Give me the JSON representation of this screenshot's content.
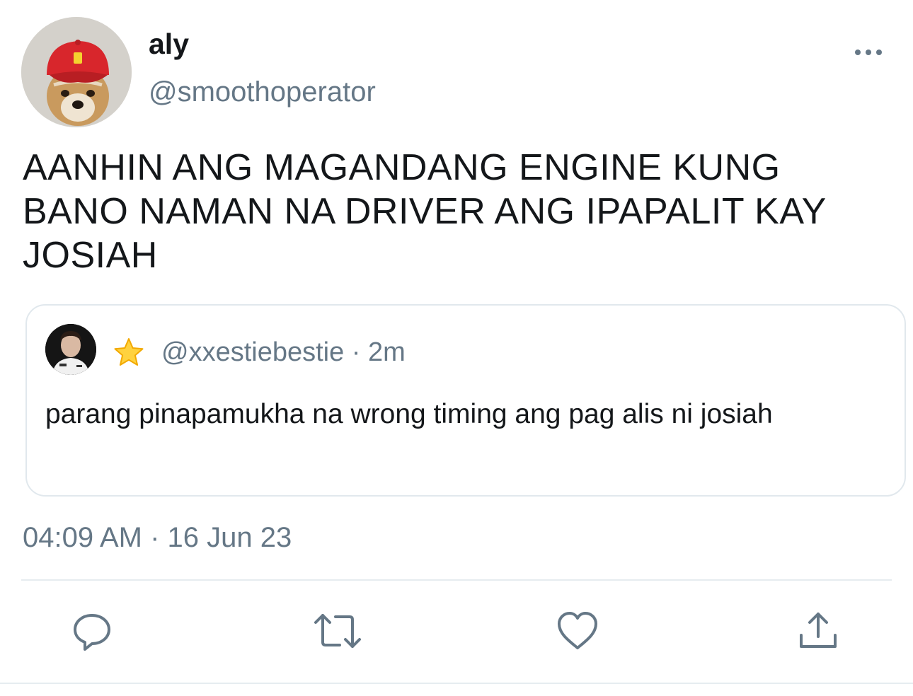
{
  "author": {
    "display_name": "aly",
    "handle": "@smoothoperator",
    "avatar_icon": "shiba-dog-red-cap-avatar"
  },
  "tweet": {
    "text": "AANHIN ANG MAGANDANG ENGINE KUNG BANO NAMAN NA DRIVER ANG IPAPALIT KAY JOSIAH",
    "timestamp": "04:09 AM · 16 Jun 23"
  },
  "quoted_tweet": {
    "emoji": "⭐",
    "header": "@xxestiebestie · 2m",
    "text": "parang pinapamukha na wrong timing ang pag alis ni josiah",
    "avatar_icon": "driver-portrait-avatar"
  },
  "actions": [
    {
      "name": "reply",
      "icon": "speech-bubble-icon"
    },
    {
      "name": "retweet",
      "icon": "retweet-arrows-icon"
    },
    {
      "name": "like",
      "icon": "heart-icon"
    },
    {
      "name": "share",
      "icon": "share-upload-icon"
    }
  ],
  "colors": {
    "primary_text": "#14171a",
    "secondary_text": "#657786",
    "border": "#e1e8ed",
    "cap_red": "#d8262c"
  }
}
